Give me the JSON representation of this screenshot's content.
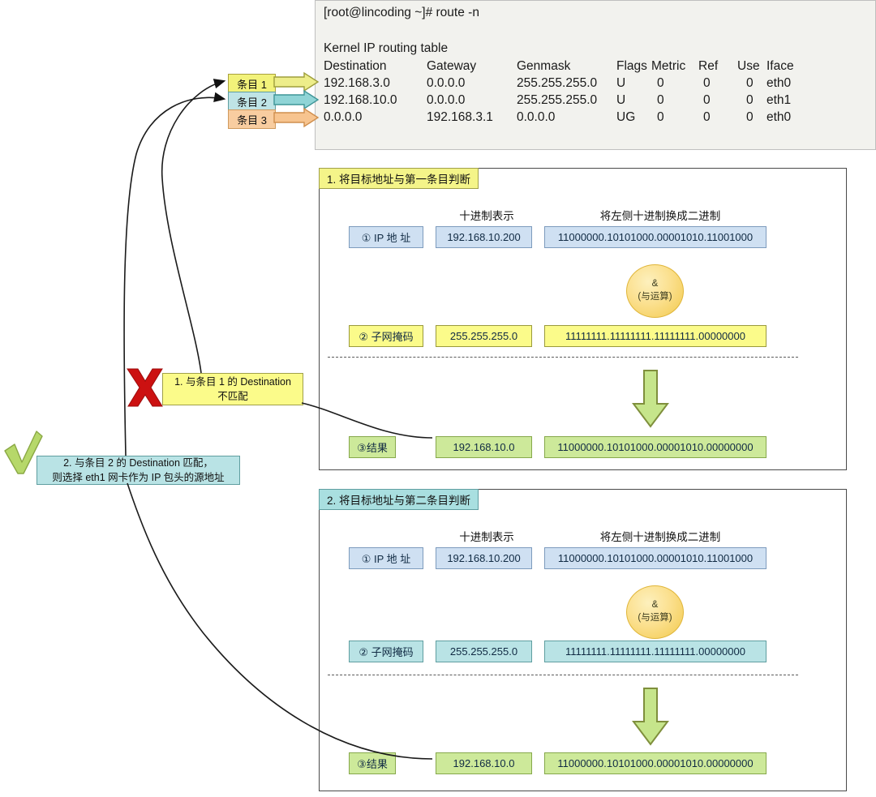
{
  "terminal": {
    "prompt_line": "[root@lincoding ~]# route -n",
    "blank": "",
    "table_caption": "Kernel IP routing table",
    "headers": [
      "Destination",
      "Gateway",
      "Genmask",
      "Flags",
      "Metric",
      "Ref",
      "Use",
      "Iface"
    ],
    "rows": [
      [
        "192.168.3.0",
        "0.0.0.0",
        "255.255.255.0",
        "U",
        "0",
        "0",
        "0",
        "eth0"
      ],
      [
        "192.168.10.0",
        "0.0.0.0",
        "255.255.255.0",
        "U",
        "0",
        "0",
        "0",
        "eth1"
      ],
      [
        "0.0.0.0",
        "192.168.3.1",
        "0.0.0.0",
        "UG",
        "0",
        "0",
        "0",
        "eth0"
      ]
    ]
  },
  "entries": [
    {
      "label": "条目 1",
      "color": "#f2f27a"
    },
    {
      "label": "条目 2",
      "color": "#bfe4e6"
    },
    {
      "label": "条目 3",
      "color": "#f8cda0"
    }
  ],
  "panel1": {
    "title": "1. 将目标地址与第一条目判断",
    "col_decimal": "十进制表示",
    "col_binary": "将左侧十进制换成二进制",
    "rows": [
      {
        "label": "① IP 地 址",
        "decimal": "192.168.10.200",
        "binary": "11000000.10101000.00001010.11001000"
      },
      {
        "label": "② 子网掩码",
        "decimal": "255.255.255.0",
        "binary": "11111111.11111111.11111111.00000000"
      },
      {
        "label": "③结果",
        "decimal": "192.168.10.0",
        "binary": "11000000.10101000.00001010.00000000"
      }
    ],
    "operator_symbol": "&",
    "operator_label": "(与运算)"
  },
  "panel2": {
    "title": "2. 将目标地址与第二条目判断",
    "col_decimal": "十进制表示",
    "col_binary": "将左侧十进制换成二进制",
    "rows": [
      {
        "label": "① IP 地 址",
        "decimal": "192.168.10.200",
        "binary": "11000000.10101000.00001010.11001000"
      },
      {
        "label": "② 子网掩码",
        "decimal": "255.255.255.0",
        "binary": "11111111.11111111.11111111.00000000"
      },
      {
        "label": "③结果",
        "decimal": "192.168.10.0",
        "binary": "11000000.10101000.00001010.00000000"
      }
    ],
    "operator_symbol": "&",
    "operator_label": "(与运算)"
  },
  "notes": {
    "mismatch_line1": "1. 与条目 1 的 Destination",
    "mismatch_line2": "不匹配",
    "match_line1": "2. 与条目 2  的 Destination 匹配，",
    "match_line2": "则选择 eth1 网卡作为 IP 包头的源地址"
  },
  "colors": {
    "yellow": "#f2f27a",
    "cyan": "#bfe4e6",
    "orange": "#f8cda0",
    "blue_cell": "#cfe0f2",
    "green_cell": "#cde99a",
    "gold_ellipse": "#f2c94c",
    "cross_red": "#cc1111",
    "check_green": "#aacd60"
  }
}
